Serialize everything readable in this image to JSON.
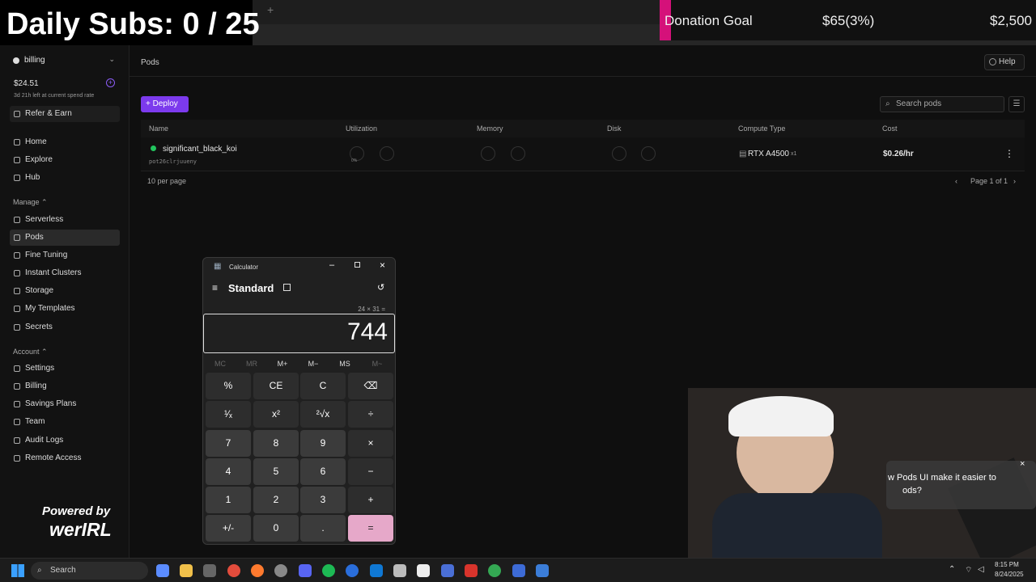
{
  "overlay": {
    "daily_subs": "Daily Subs: 0 / 25",
    "donation_label": "Donation Goal",
    "donation_amount": "$65(3%)",
    "donation_goal": "$2,500",
    "donation_progress": 0.03,
    "powered_by": "Powered by",
    "brand": "werIRL"
  },
  "sidebar": {
    "workspace": "billing",
    "balance": "$24.51",
    "spend_note": "3d 21h left at current spend rate",
    "refer": "Refer & Earn",
    "nav": [
      {
        "label": "Home",
        "icon": "home-icon"
      },
      {
        "label": "Explore",
        "icon": "explore-icon"
      },
      {
        "label": "Hub",
        "icon": "hub-icon"
      }
    ],
    "manage_header": "Manage",
    "manage": [
      {
        "label": "Serverless",
        "icon": "cloud-icon"
      },
      {
        "label": "Pods",
        "icon": "pods-icon",
        "active": true
      },
      {
        "label": "Fine Tuning",
        "icon": "tune-icon"
      },
      {
        "label": "Instant Clusters",
        "icon": "cluster-icon"
      },
      {
        "label": "Storage",
        "icon": "storage-icon"
      },
      {
        "label": "My Templates",
        "icon": "template-icon"
      },
      {
        "label": "Secrets",
        "icon": "key-icon"
      }
    ],
    "account_header": "Account",
    "account": [
      {
        "label": "Settings",
        "icon": "gear-icon"
      },
      {
        "label": "Billing",
        "icon": "billing-icon"
      },
      {
        "label": "Savings Plans",
        "icon": "savings-icon"
      },
      {
        "label": "Team",
        "icon": "team-icon"
      },
      {
        "label": "Audit Logs",
        "icon": "log-icon"
      },
      {
        "label": "Remote Access",
        "icon": "remote-icon"
      }
    ]
  },
  "main": {
    "title": "Pods",
    "help": "Help",
    "deploy": "Deploy",
    "search_placeholder": "Search pods",
    "columns": [
      "Name",
      "Utilization",
      "Memory",
      "Disk",
      "Compute Type",
      "Cost"
    ],
    "pod": {
      "name": "significant_black_koi",
      "id": "pot26clrjuueny",
      "gpu": "RTX A4500",
      "gpu_count": "x1",
      "cost": "$0.26/hr",
      "gauge_value": "0%",
      "status_color": "#22c55e"
    },
    "per_page": "10 per page",
    "page_info": "Page 1 of 1"
  },
  "calculator": {
    "title": "Calculator",
    "mode": "Standard",
    "expression": "24 × 31 =",
    "result": "744",
    "memory": [
      "MC",
      "MR",
      "M+",
      "M−",
      "MS",
      "M~"
    ],
    "keys": [
      [
        "%",
        "CE",
        "C",
        "⌫"
      ],
      [
        "¹⁄ₓ",
        "x²",
        "²√x",
        "÷"
      ],
      [
        "7",
        "8",
        "9",
        "×"
      ],
      [
        "4",
        "5",
        "6",
        "−"
      ],
      [
        "1",
        "2",
        "3",
        "+"
      ],
      [
        "+/-",
        "0",
        ".",
        "="
      ]
    ],
    "accent": "#e6a8c9"
  },
  "popup": {
    "text_line1": "w Pods UI make it easier to",
    "text_line2": "ods?"
  },
  "taskbar": {
    "search": "Search",
    "time": "8:15 PM",
    "date": "8/24/2025"
  }
}
